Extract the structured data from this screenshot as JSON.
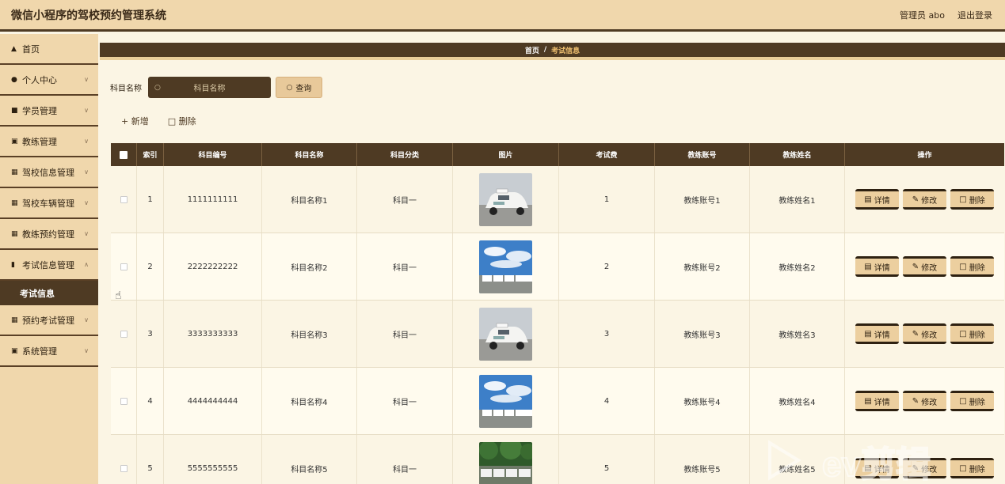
{
  "header": {
    "title": "微信小程序的驾校预约管理系统",
    "user_label": "管理员 abo",
    "logout_label": "退出登录"
  },
  "sidebar": {
    "items": [
      {
        "label": "首页",
        "icon": "home-icon"
      },
      {
        "label": "个人中心",
        "icon": "person-icon"
      },
      {
        "label": "学员管理",
        "icon": "briefcase-icon"
      },
      {
        "label": "教练管理",
        "icon": "clipboard-icon"
      },
      {
        "label": "驾校信息管理",
        "icon": "grid-icon"
      },
      {
        "label": "驾校车辆管理",
        "icon": "grid-icon"
      },
      {
        "label": "教练预约管理",
        "icon": "grid-icon"
      },
      {
        "label": "考试信息管理",
        "icon": "bar-chart-icon"
      },
      {
        "label": "预约考试管理",
        "icon": "grid-icon"
      },
      {
        "label": "系统管理",
        "icon": "settings-icon"
      }
    ],
    "active_sub": "考试信息"
  },
  "breadcrumb": {
    "home": "首页",
    "separator": "/",
    "current": "考试信息"
  },
  "search": {
    "label": "科目名称",
    "placeholder": "科目名称",
    "button": "查询"
  },
  "actions": {
    "add": "新增",
    "delete": "删除"
  },
  "table": {
    "headers": [
      "索引",
      "科目编号",
      "科目名称",
      "科目分类",
      "图片",
      "考试费",
      "教练账号",
      "教练姓名",
      "操作"
    ],
    "rows": [
      {
        "index": "1",
        "code": "1111111111",
        "name": "科目名称1",
        "category": "科目一",
        "fee": "1",
        "coach_account": "教练账号1",
        "coach_name": "教练姓名1",
        "image": "taxi"
      },
      {
        "index": "2",
        "code": "2222222222",
        "name": "科目名称2",
        "category": "科目一",
        "fee": "2",
        "coach_account": "教练账号2",
        "coach_name": "教练姓名2",
        "image": "lot"
      },
      {
        "index": "3",
        "code": "3333333333",
        "name": "科目名称3",
        "category": "科目一",
        "fee": "3",
        "coach_account": "教练账号3",
        "coach_name": "教练姓名3",
        "image": "taxi"
      },
      {
        "index": "4",
        "code": "4444444444",
        "name": "科目名称4",
        "category": "科目一",
        "fee": "4",
        "coach_account": "教练账号4",
        "coach_name": "教练姓名4",
        "image": "lot"
      },
      {
        "index": "5",
        "code": "5555555555",
        "name": "科目名称5",
        "category": "科目一",
        "fee": "5",
        "coach_account": "教练账号5",
        "coach_name": "教练姓名5",
        "image": "trees"
      }
    ],
    "op_labels": {
      "detail": "详情",
      "edit": "修改",
      "delete": "删除"
    }
  },
  "colors": {
    "primary": "#4e3a23",
    "accent": "#f0d7ac",
    "background": "#fbf5e4"
  }
}
